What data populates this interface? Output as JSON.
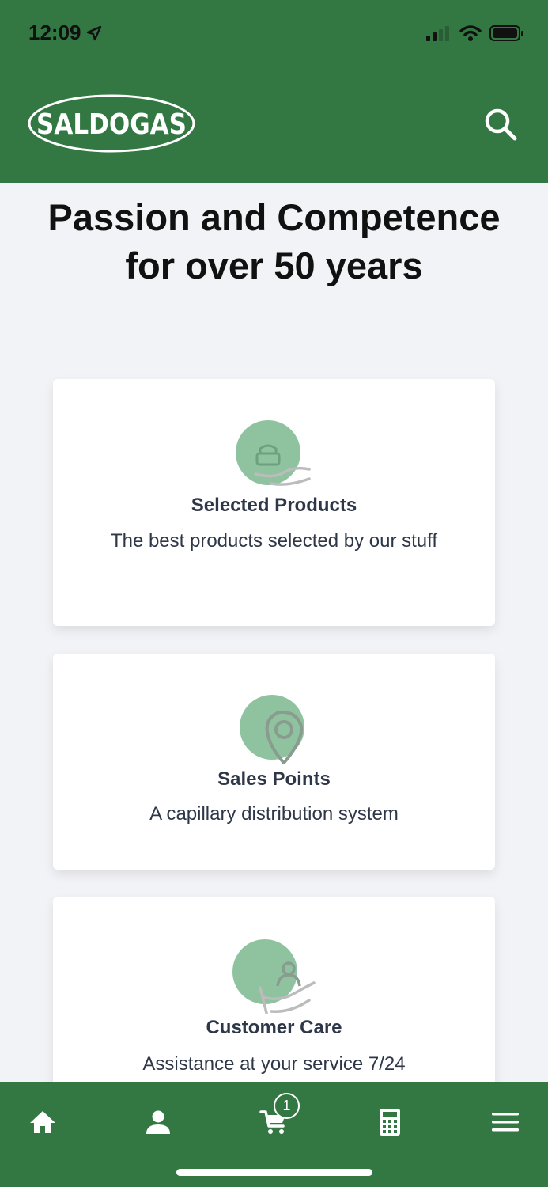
{
  "status_bar": {
    "time": "12:09"
  },
  "header": {
    "logo_text": "SALDOGAS",
    "search_icon": "search-icon",
    "color": "#337843"
  },
  "hero": {
    "title": "Passion and Competence for over 50 years"
  },
  "cards": [
    {
      "title": "Selected Products",
      "description": "The best products selected by our stuff",
      "icon": "basket-in-hand-icon"
    },
    {
      "title": "Sales Points",
      "description": "A capillary distribution system",
      "icon": "location-pin-icon"
    },
    {
      "title": "Customer Care",
      "description": "Assistance at your service 7/24",
      "icon": "person-in-hand-icon"
    }
  ],
  "bottom_nav": {
    "items": [
      "home-icon",
      "user-icon",
      "cart-icon",
      "calculator-icon",
      "menu-icon"
    ],
    "cart_count": "1"
  },
  "colors": {
    "brand_green": "#337843",
    "icon_circle": "#8fc39f",
    "background": "#f2f3f7"
  }
}
